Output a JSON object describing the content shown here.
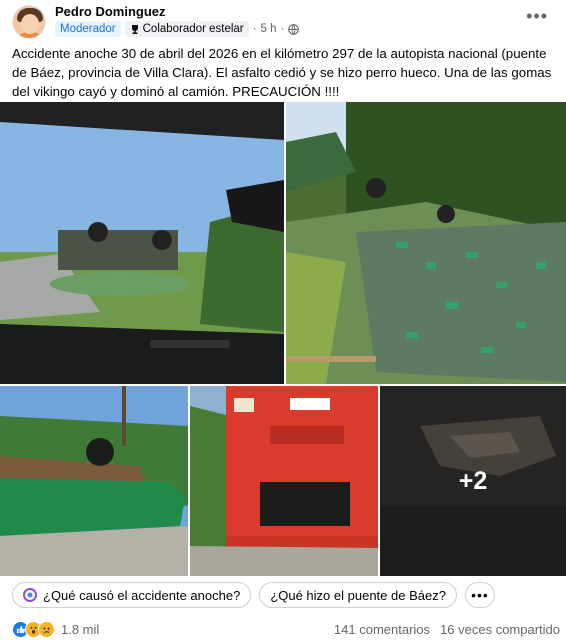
{
  "post": {
    "author": "Pedro Dominguez",
    "badge_role": "Moderador",
    "badge_top": "Colaborador estelar",
    "time": "5 h",
    "separator": "·",
    "text": "Accidente anoche 30 de abril del 2026 en el kilómetro 297 de la autopista nacional (puente de Báez, provincia de Villa Clara). El asfalto cedió y se hizo perro hueco. Una de las gomas del vikingo cayó y dominó al camión. PRECAUCIÓN !!!!",
    "more_icon": "more-horizontal-icon",
    "extra_photos": "+2"
  },
  "suggestions": [
    {
      "label": "¿Qué causó el accidente anoche?"
    },
    {
      "label": "¿Qué hizo el puente de Báez?"
    }
  ],
  "reactions": {
    "count": "1.8 mil",
    "icons": [
      "like-icon",
      "wow-icon",
      "sad-icon"
    ]
  },
  "stats": {
    "comments": "141 comentarios",
    "shares": "16 veces compartido"
  },
  "colors": {
    "accent": "#1877f2",
    "badge_bg": "#e7f3ff",
    "muted_text": "#65676b"
  }
}
